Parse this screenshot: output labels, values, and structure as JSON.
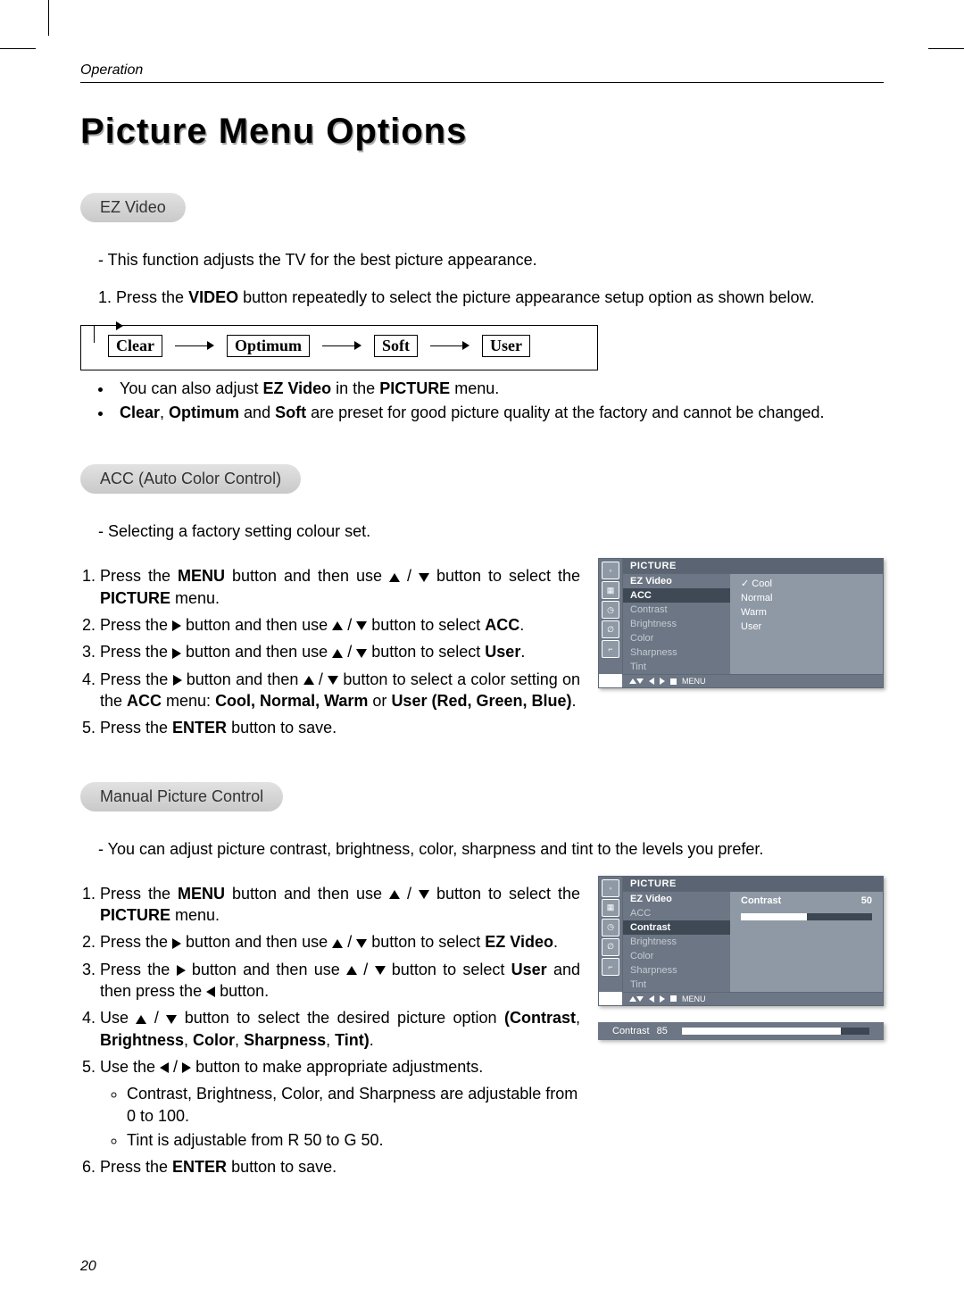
{
  "running_header": "Operation",
  "page_title": "Picture Menu Options",
  "page_number": "20",
  "ez_video": {
    "pill": "EZ Video",
    "intro": "This function adjusts the TV for the best picture appearance.",
    "step1_pre": "Press the ",
    "step1_btn": "VIDEO",
    "step1_post": " button repeatedly to select the picture appearance setup option as shown below.",
    "flow": [
      "Clear",
      "Optimum",
      "Soft",
      "User"
    ],
    "note1_pre": "You can also adjust ",
    "note1_b": "EZ Video",
    "note1_mid": " in the ",
    "note1_b2": "PICTURE",
    "note1_post": " menu.",
    "note2_b1": "Clear",
    "note2_s1": ", ",
    "note2_b2": "Optimum",
    "note2_s2": " and ",
    "note2_b3": "Soft",
    "note2_post": " are preset for good picture quality at the factory and cannot be changed."
  },
  "acc": {
    "pill": "ACC (Auto Color Control)",
    "intro": "Selecting a factory setting colour set.",
    "s1_pre": "Press the ",
    "s1_b": "MENU",
    "s1_mid": " button and then use ",
    "s1_post": " button to select the ",
    "s1_b2": "PICTURE",
    "s1_end": " menu.",
    "s2_pre": "Press the ",
    "s2_mid": " button and then use ",
    "s2_post": " button to select ",
    "s2_b": "ACC",
    "s2_end": ".",
    "s3_pre": "Press the ",
    "s3_mid": " button and then use ",
    "s3_post": " button to select ",
    "s3_b": "User",
    "s3_end": ".",
    "s4_pre": "Press the ",
    "s4_mid": " button and then ",
    "s4_post": " button to select a color setting on the ",
    "s4_b1": "ACC",
    "s4_mid2": " menu: ",
    "s4_b2": "Cool, Normal, Warm",
    "s4_or": " or ",
    "s4_b3": "User (Red, Green, Blue)",
    "s4_end": ".",
    "s5_pre": "Press the ",
    "s5_b": "ENTER",
    "s5_post": " button to save.",
    "osd": {
      "title": "PICTURE",
      "items": [
        "EZ Video",
        "ACC",
        "Contrast",
        "Brightness",
        "Color",
        "Sharpness",
        "Tint"
      ],
      "selected": "ACC",
      "options": [
        "Cool",
        "Normal",
        "Warm",
        "User"
      ],
      "checked": "Cool",
      "foot_label": "MENU"
    }
  },
  "manual": {
    "pill": "Manual Picture Control",
    "intro": "You can adjust picture contrast, brightness, color, sharpness and tint to the levels you prefer.",
    "s1_pre": "Press the ",
    "s1_b": "MENU",
    "s1_mid": " button and then use ",
    "s1_post": " button to select the ",
    "s1_b2": "PICTURE",
    "s1_end": " menu.",
    "s2_pre": "Press the ",
    "s2_mid": " button and then use ",
    "s2_post": " button to select ",
    "s2_b": "EZ Video",
    "s2_end": ".",
    "s3_pre": "Press the ",
    "s3_mid": " button and then use ",
    "s3_post": " button to select ",
    "s3_b": "User",
    "s3_mid2": " and then press the ",
    "s3_end": " button.",
    "s4_pre": "Use ",
    "s4_post": " button to select the desired picture option ",
    "s4_b": "(Contrast",
    "s4_s1": ", ",
    "s4_b2": "Brightness",
    "s4_s2": ", ",
    "s4_b3": "Color",
    "s4_s3": ", ",
    "s4_b4": "Sharpness",
    "s4_s4": ", ",
    "s4_b5": "Tint)",
    "s4_end": ".",
    "s5_pre": "Use the ",
    "s5_post": " button to make appropriate adjustments.",
    "s5_n1": "Contrast, Brightness, Color, and Sharpness are adjustable from 0 to 100.",
    "s5_n2": "Tint is adjustable from R 50 to G 50.",
    "s6_pre": "Press the ",
    "s6_b": "ENTER",
    "s6_post": " button to save.",
    "osd": {
      "title": "PICTURE",
      "items": [
        "EZ Video",
        "ACC",
        "Contrast",
        "Brightness",
        "Color",
        "Sharpness",
        "Tint"
      ],
      "selected": "Contrast",
      "value_label": "Contrast",
      "value": "50",
      "foot_label": "MENU"
    },
    "strip": {
      "label": "Contrast",
      "value": "85",
      "fill_pct": 85
    }
  }
}
